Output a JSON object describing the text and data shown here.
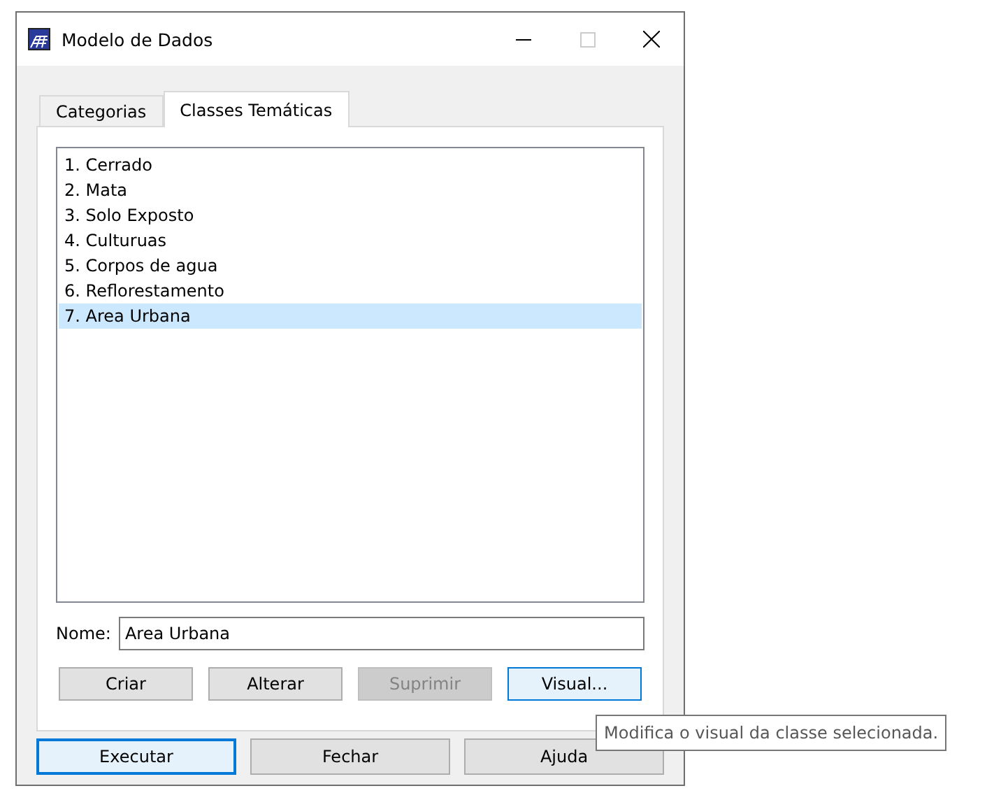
{
  "window": {
    "title": "Modelo de Dados"
  },
  "tabs": [
    {
      "label": "Categorias",
      "selected": false
    },
    {
      "label": "Classes Temáticas",
      "selected": true
    }
  ],
  "list": {
    "items": [
      {
        "label": "1. Cerrado",
        "selected": false
      },
      {
        "label": "2. Mata",
        "selected": false
      },
      {
        "label": "3. Solo Exposto",
        "selected": false
      },
      {
        "label": "4. Culturuas",
        "selected": false
      },
      {
        "label": "5. Corpos de agua",
        "selected": false
      },
      {
        "label": "6. Reflorestamento",
        "selected": false
      },
      {
        "label": "7. Area Urbana",
        "selected": true
      }
    ]
  },
  "name_field": {
    "label": "Nome:",
    "value": "Area Urbana"
  },
  "class_buttons": [
    {
      "label": "Criar",
      "disabled": false,
      "focused": false
    },
    {
      "label": "Alterar",
      "disabled": false,
      "focused": false
    },
    {
      "label": "Suprimir",
      "disabled": true,
      "focused": false
    },
    {
      "label": "Visual...",
      "disabled": false,
      "focused": true
    }
  ],
  "dialog_buttons": [
    {
      "label": "Executar",
      "disabled": false,
      "focused": true
    },
    {
      "label": "Fechar",
      "disabled": false,
      "focused": false
    },
    {
      "label": "Ajuda",
      "disabled": false,
      "focused": false
    }
  ],
  "tooltip": {
    "text": "Modifica o visual da classe selecionada."
  }
}
